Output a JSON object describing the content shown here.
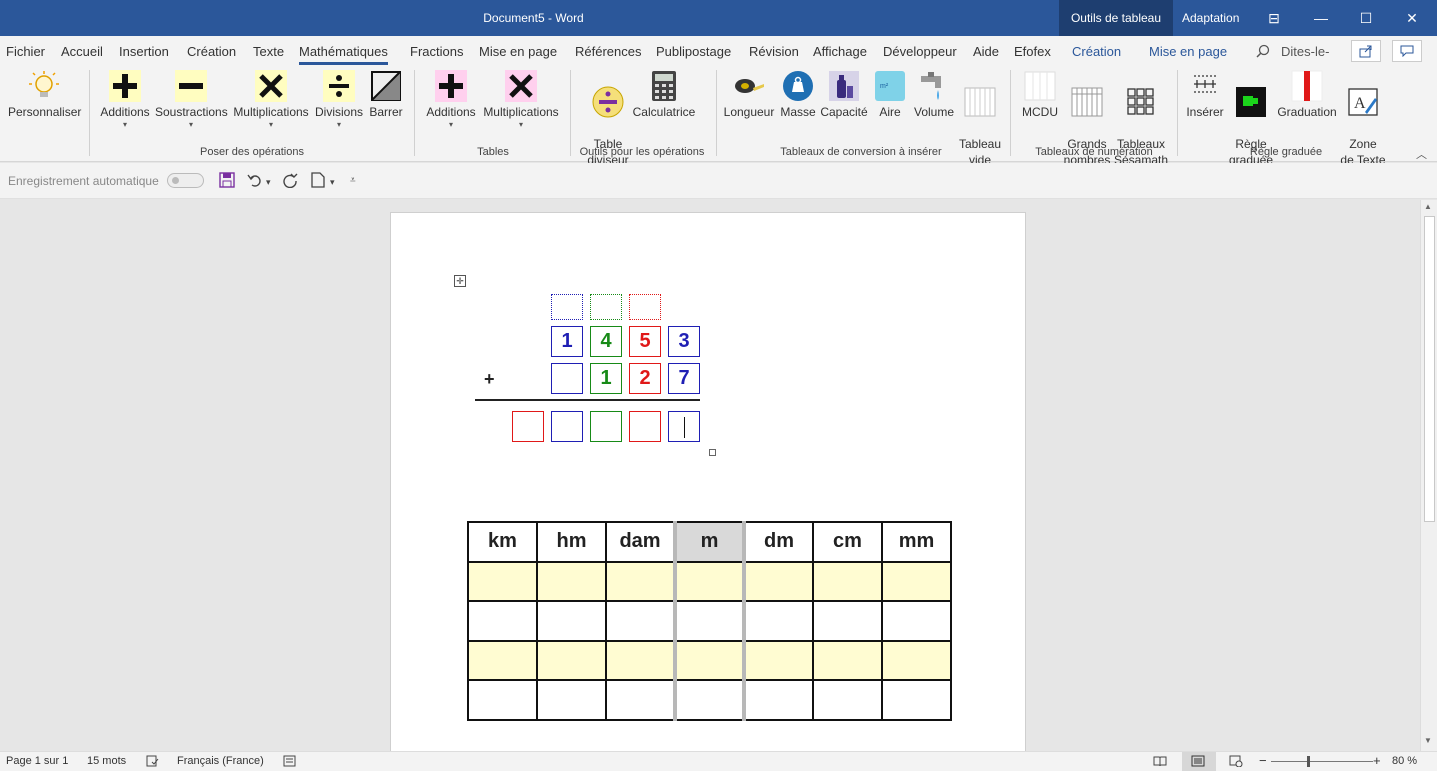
{
  "window": {
    "title": "Document5 - Word",
    "context_tab": "Outils de tableau",
    "adaptation": "Adaptation",
    "controls": {
      "ribbon_display": "⊟",
      "minimize": "—",
      "maximize": "☐",
      "close": "✕"
    }
  },
  "menu": {
    "tabs": [
      "Fichier",
      "Accueil",
      "Insertion",
      "Création",
      "Texte",
      "Mathématiques",
      "Fractions",
      "Mise en page",
      "Références",
      "Publipostage",
      "Révision",
      "Affichage",
      "Développeur",
      "Aide",
      "Efofex"
    ],
    "active_tab": "Mathématiques",
    "context_tabs": [
      "Création",
      "Mise en page"
    ],
    "tell_me": "Dites-le-",
    "share_icon": "share-icon",
    "comments_icon": "comment-icon"
  },
  "ribbon": {
    "items": {
      "personnaliser": "Personnaliser",
      "additions": "Additions",
      "soustractions": "Soustractions",
      "multiplications": "Multiplications",
      "divisions": "Divisions",
      "barrer": "Barrer",
      "tables_additions": "Additions",
      "tables_multiplications": "Multiplications",
      "table_diviseur": "Table\ndiviseur",
      "calculatrice": "Calculatrice",
      "longueur": "Longueur",
      "masse": "Masse",
      "capacite": "Capacité",
      "aire": "Aire",
      "volume": "Volume",
      "tableau_vide": "Tableau\nvide",
      "mcdu": "MCDU",
      "grands_nombres": "Grands\nnombres",
      "tableaux_sesamath": "Tableaux\nSésamath",
      "inserer": "Insérer",
      "regle_graduee": "Règle\ngraduée",
      "graduation": "Graduation",
      "zone_texte": "Zone\nde Texte"
    },
    "groups": {
      "poser": "Poser des opérations",
      "tables": "Tables",
      "outils": "Outils pour les opérations",
      "conversion": "Tableaux de conversion à insérer",
      "numeration": "Tableaux de numération",
      "regle": "Règle graduée"
    }
  },
  "quick_access": {
    "autosave": "Enregistrement automatique",
    "icons": [
      "save-icon",
      "undo-icon",
      "redo-icon",
      "new-doc-icon",
      "customize-icon"
    ]
  },
  "document": {
    "addition": {
      "operator": "+",
      "row1": [
        "1",
        "4",
        "5",
        "3"
      ],
      "row2": [
        "",
        "1",
        "2",
        "7"
      ],
      "result": [
        "",
        "",
        "",
        "",
        ""
      ]
    },
    "conversion_table": {
      "headers": [
        "km",
        "hm",
        "dam",
        "m",
        "dm",
        "cm",
        "mm"
      ],
      "rows": 4,
      "highlight_column": "m"
    }
  },
  "status": {
    "page": "Page 1 sur 1",
    "words": "15 mots",
    "language": "Français (France)",
    "zoom": "80 %"
  },
  "colors": {
    "brand": "#2b579a",
    "blue_digit": "#1f1fb4",
    "green_digit": "#178a17",
    "red_digit": "#e01818",
    "table_yellow": "#fffcd2"
  }
}
